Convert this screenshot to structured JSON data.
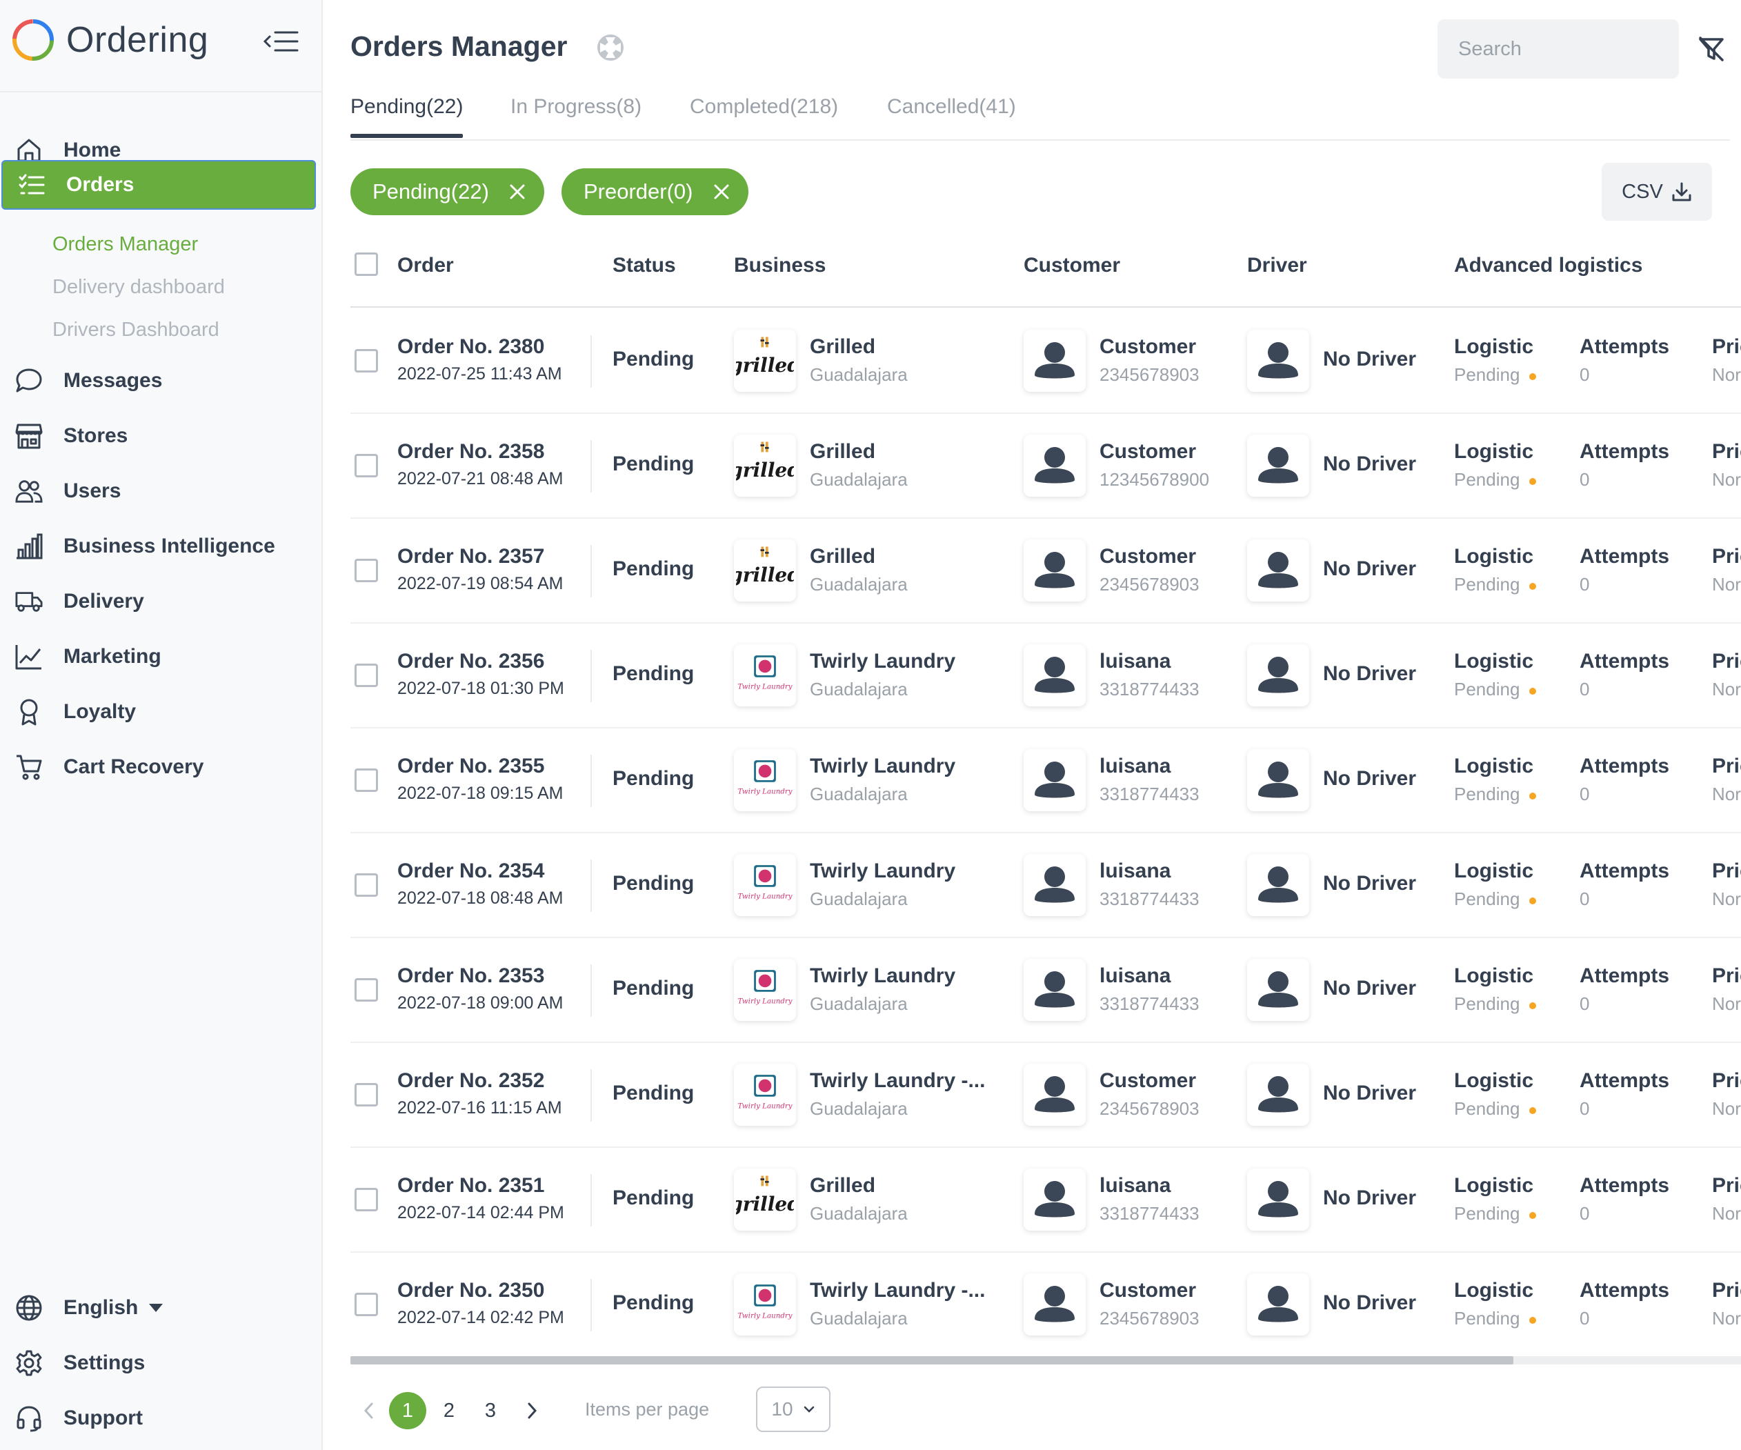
{
  "brand": {
    "name": "Ordering"
  },
  "nav": {
    "items": [
      {
        "label": "Home",
        "icon": "home-icon"
      },
      {
        "label": "Orders",
        "icon": "list-icon"
      },
      {
        "label": "Messages",
        "icon": "chat-icon"
      },
      {
        "label": "Stores",
        "icon": "store-icon"
      },
      {
        "label": "Users",
        "icon": "users-icon"
      },
      {
        "label": "Business Intelligence",
        "icon": "bar-chart-icon"
      },
      {
        "label": "Delivery",
        "icon": "truck-icon"
      },
      {
        "label": "Marketing",
        "icon": "line-chart-icon"
      },
      {
        "label": "Loyalty",
        "icon": "award-icon"
      },
      {
        "label": "Cart Recovery",
        "icon": "cart-icon"
      }
    ],
    "orders_sub": [
      "Orders Manager",
      "Delivery dashboard",
      "Drivers Dashboard"
    ],
    "bottom": {
      "language": "English",
      "settings": "Settings",
      "support": "Support"
    }
  },
  "header": {
    "title": "Orders Manager",
    "search_placeholder": "Search"
  },
  "tabs": [
    "Pending(22)",
    "In Progress(8)",
    "Completed(218)",
    "Cancelled(41)"
  ],
  "chips": [
    "Pending(22)",
    "Preorder(0)"
  ],
  "csv_label": "CSV",
  "columns": [
    "Order",
    "Status",
    "Business",
    "Customer",
    "Driver",
    "Advanced logistics"
  ],
  "logistics_labels": {
    "logistic": "Logistic",
    "pending": "Pending",
    "attempts": "Attempts",
    "attempts_value": "0",
    "priority": "Priority",
    "priority_value": "Normal"
  },
  "orders": [
    {
      "no": "Order No. 2380",
      "date": "2022-07-25 11:43 AM",
      "status": "Pending",
      "business": "Grilled",
      "logo": "grilled",
      "city": "Guadalajara",
      "customer": "Customer",
      "phone": "2345678903",
      "driver": "No Driver"
    },
    {
      "no": "Order No. 2358",
      "date": "2022-07-21 08:48 AM",
      "status": "Pending",
      "business": "Grilled",
      "logo": "grilled",
      "city": "Guadalajara",
      "customer": "Customer",
      "phone": "12345678900",
      "driver": "No Driver"
    },
    {
      "no": "Order No. 2357",
      "date": "2022-07-19 08:54 AM",
      "status": "Pending",
      "business": "Grilled",
      "logo": "grilled",
      "city": "Guadalajara",
      "customer": "Customer",
      "phone": "2345678903",
      "driver": "No Driver"
    },
    {
      "no": "Order No. 2356",
      "date": "2022-07-18 01:30 PM",
      "status": "Pending",
      "business": "Twirly Laundry",
      "logo": "laundry",
      "city": "Guadalajara",
      "customer": "luisana",
      "phone": "3318774433",
      "driver": "No Driver"
    },
    {
      "no": "Order No. 2355",
      "date": "2022-07-18 09:15 AM",
      "status": "Pending",
      "business": "Twirly Laundry",
      "logo": "laundry",
      "city": "Guadalajara",
      "customer": "luisana",
      "phone": "3318774433",
      "driver": "No Driver"
    },
    {
      "no": "Order No. 2354",
      "date": "2022-07-18 08:48 AM",
      "status": "Pending",
      "business": "Twirly Laundry",
      "logo": "laundry",
      "city": "Guadalajara",
      "customer": "luisana",
      "phone": "3318774433",
      "driver": "No Driver"
    },
    {
      "no": "Order No. 2353",
      "date": "2022-07-18 09:00 AM",
      "status": "Pending",
      "business": "Twirly Laundry",
      "logo": "laundry",
      "city": "Guadalajara",
      "customer": "luisana",
      "phone": "3318774433",
      "driver": "No Driver"
    },
    {
      "no": "Order No. 2352",
      "date": "2022-07-16 11:15 AM",
      "status": "Pending",
      "business": "Twirly Laundry -...",
      "logo": "laundry",
      "city": "Guadalajara",
      "customer": "Customer",
      "phone": "2345678903",
      "driver": "No Driver"
    },
    {
      "no": "Order No. 2351",
      "date": "2022-07-14 02:44 PM",
      "status": "Pending",
      "business": "Grilled",
      "logo": "grilled",
      "city": "Guadalajara",
      "customer": "luisana",
      "phone": "3318774433",
      "driver": "No Driver"
    },
    {
      "no": "Order No. 2350",
      "date": "2022-07-14 02:42 PM",
      "status": "Pending",
      "business": "Twirly Laundry -...",
      "logo": "laundry",
      "city": "Guadalajara",
      "customer": "Customer",
      "phone": "2345678903",
      "driver": "No Driver"
    }
  ],
  "pagination": {
    "pages": [
      "1",
      "2",
      "3"
    ],
    "current": "1",
    "items_per_page_label": "Items per page",
    "items_per_page": "10"
  },
  "colors": {
    "accent": "#6aad3f",
    "text": "#344050",
    "muted": "#9aa1a9",
    "warning": "#f5a623"
  }
}
